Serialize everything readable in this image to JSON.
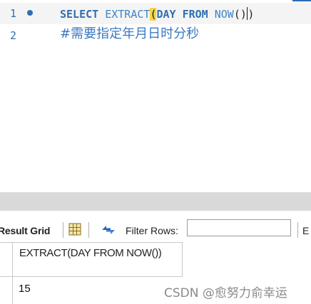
{
  "editor": {
    "lines": [
      {
        "number": "1",
        "tokens": {
          "select": "SELECT",
          "extract": "EXTRACT",
          "open_paren": "(",
          "day": "DAY",
          "from": "FROM",
          "now": "NOW",
          "parens": "()",
          "close_paren": ")"
        }
      },
      {
        "number": "2",
        "comment": "#需要指定年月日时分秒"
      }
    ]
  },
  "toolbar": {
    "result_label": "Result Grid",
    "filter_label": "Filter Rows:",
    "filter_value": "",
    "right_label": "E"
  },
  "grid": {
    "columns": [
      {
        "header": "EXTRACT(DAY FROM NOW())"
      }
    ],
    "rows": [
      [
        "15"
      ]
    ]
  },
  "watermark": "CSDN @愈努力俞幸运",
  "colors": {
    "keyword": "#2f6fb0",
    "function": "#3f84c8",
    "bracket_highlight": "#f2d54a",
    "splitter": "#d9d9d9"
  },
  "icons": [
    "bullet-marker-icon",
    "grid-layout-icon",
    "refresh-arrows-icon"
  ]
}
